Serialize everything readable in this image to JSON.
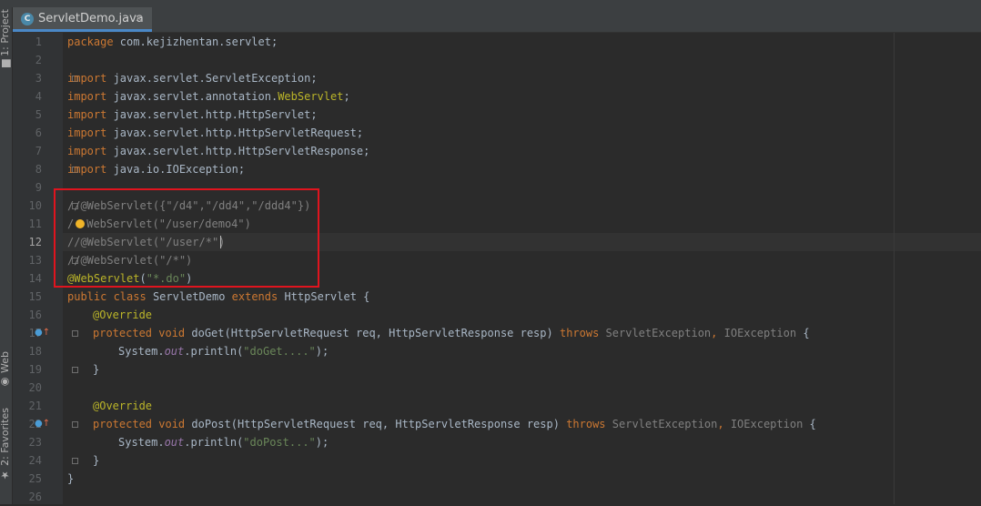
{
  "editor": {
    "tab": {
      "icon": "C",
      "label": "ServletDemo.java",
      "close": "✕"
    },
    "tool_windows": {
      "project": "1: Project",
      "web": "Web",
      "favorites": "2: Favorites"
    }
  },
  "line_numbers": [
    "1",
    "2",
    "3",
    "4",
    "5",
    "6",
    "7",
    "8",
    "9",
    "10",
    "11",
    "12",
    "13",
    "14",
    "15",
    "16",
    "17",
    "18",
    "19",
    "20",
    "21",
    "22",
    "23",
    "24",
    "25",
    "26"
  ],
  "code": {
    "l1": {
      "kw": "package",
      "rest": " com.kejizhentan.servlet;"
    },
    "l3": {
      "kw": "import",
      "rest": " javax.servlet.ServletException;"
    },
    "l4": {
      "kw": "import",
      "rest": " javax.servlet.annotation.",
      "ann": "WebServlet",
      "end": ";"
    },
    "l5": {
      "kw": "import",
      "rest": " javax.servlet.http.HttpServlet;"
    },
    "l6": {
      "kw": "import",
      "rest": " javax.servlet.http.HttpServletRequest;"
    },
    "l7": {
      "kw": "import",
      "rest": " javax.servlet.http.HttpServletResponse;"
    },
    "l8": {
      "kw": "import",
      "rest": " java.io.IOException;"
    },
    "l10": {
      "comment": "//@WebServlet({\"/d4\",\"/dd4\",\"/ddd4\"})"
    },
    "l11": {
      "comment_a": "/",
      "comment_b": "WebServlet(\"/user/demo4\")"
    },
    "l12": {
      "comment": "//@WebServlet(\"/user/*\")"
    },
    "l13": {
      "comment": "//@WebServlet(\"/*\")"
    },
    "l14": {
      "ann": "@WebServlet",
      "open": "(",
      "str": "\"*.do\"",
      "close": ")"
    },
    "l15": {
      "kw1": "public",
      "kw2": " class",
      "name": " ServletDemo",
      "kw3": " extends",
      "rest": " HttpServlet {"
    },
    "l16": {
      "ann": "@Override"
    },
    "l17": {
      "kw1": "protected",
      "kw2": " void",
      "name": " doGet(HttpServletRequest req, HttpServletResponse resp) ",
      "kw3": "throws",
      "ex1": " ServletException",
      "sep": ",",
      "ex2": " IOException",
      "end": " {"
    },
    "l18": {
      "pre": "System.",
      "field": "out",
      "mid": ".println(",
      "str": "\"doGet....\"",
      "end": ");"
    },
    "l19": {
      "text": "}"
    },
    "l21": {
      "ann": "@Override"
    },
    "l22": {
      "kw1": "protected",
      "kw2": " void",
      "name": " doPost(HttpServletRequest req, HttpServletResponse resp) ",
      "kw3": "throws",
      "ex1": " ServletException",
      "sep": ",",
      "ex2": " IOException",
      "end": " {"
    },
    "l23": {
      "pre": "System.",
      "field": "out",
      "mid": ".println(",
      "str": "\"doPost...\"",
      "end": ");"
    },
    "l24": {
      "text": "}"
    },
    "l25": {
      "text": "}"
    }
  },
  "colors": {
    "keyword": "#cc7832",
    "annotation": "#bbb529",
    "string": "#6a8759",
    "comment": "#808080",
    "highlight_box": "#e0141e"
  }
}
